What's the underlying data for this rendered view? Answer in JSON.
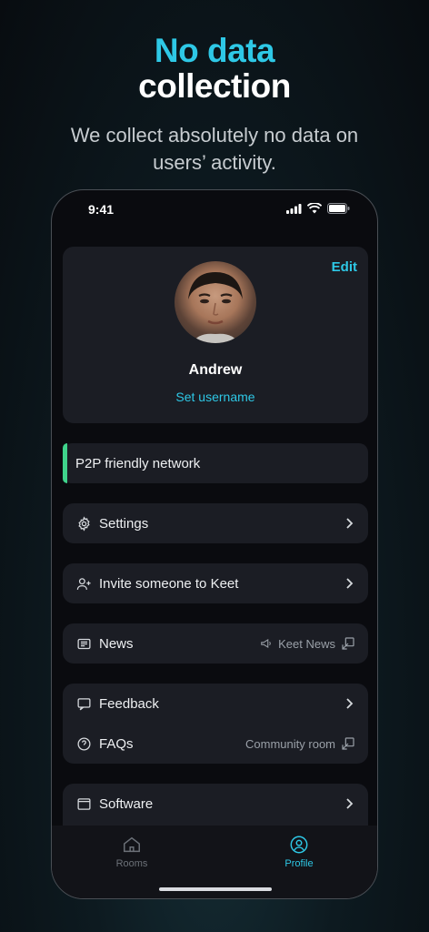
{
  "headline": {
    "line1": "No data",
    "line2": "collection"
  },
  "subtitle": "We collect absolutely no data on users’ activity.",
  "status_bar": {
    "time": "9:41"
  },
  "profile": {
    "edit_label": "Edit",
    "name": "Andrew",
    "username_link": "Set username"
  },
  "banner": {
    "label": "P2P friendly network",
    "accent": "#3fd38b"
  },
  "menu": {
    "settings": "Settings",
    "invite": "Invite someone to Keet",
    "news": "News",
    "news_link": "Keet News",
    "feedback": "Feedback",
    "faqs": "FAQs",
    "faqs_link": "Community room",
    "software": "Software"
  },
  "tabs": [
    {
      "label": "Rooms",
      "icon": "home-icon",
      "active": false
    },
    {
      "label": "Profile",
      "icon": "profile-icon",
      "active": true
    }
  ],
  "colors": {
    "accent": "#2ec8e6",
    "card": "#1b1d24",
    "background": "#0a0b0f"
  }
}
